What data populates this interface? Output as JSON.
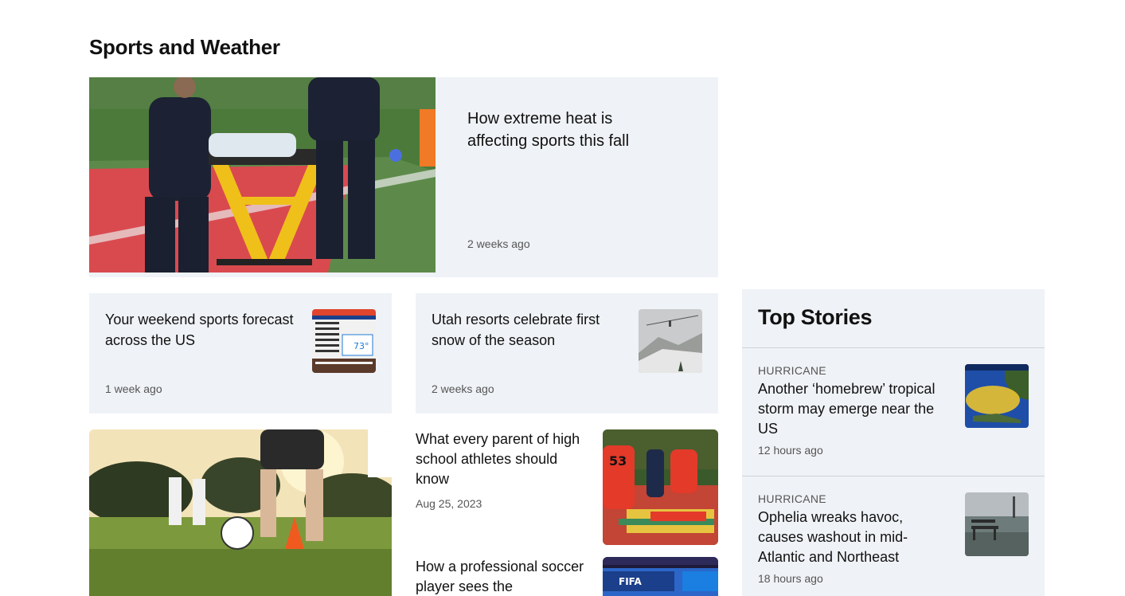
{
  "section": {
    "title": "Sports and Weather"
  },
  "hero": {
    "title": "How extreme heat is affecting sports this fall",
    "time": "2 weeks ago",
    "image": "paramedics-stretcher-field"
  },
  "cards": [
    {
      "title": "Your weekend sports forecast across the US",
      "time": "1 week ago",
      "thumb": "weather-forecast-screen"
    },
    {
      "title": "Utah resorts celebrate first snow of the season",
      "time": "2 weeks ago",
      "thumb": "snowy-ski-lift"
    }
  ],
  "big_image": "youth-soccer-practice",
  "stories": [
    {
      "title": "What every parent of high school athletes should know",
      "time": "Aug 25, 2023",
      "thumb": "football-training-drill"
    },
    {
      "title": "How a professional soccer player sees the",
      "time": "",
      "thumb": "fifa-stadium-screen"
    }
  ],
  "top_stories": {
    "title": "Top Stories",
    "items": [
      {
        "category": "HURRICANE",
        "headline": "Another ‘homebrew’ tropical storm may emerge near the US",
        "time": "12 hours ago",
        "thumb": "storm-map"
      },
      {
        "category": "HURRICANE",
        "headline": "Ophelia wreaks havoc, causes washout in mid-Atlantic and Northeast",
        "time": "18 hours ago",
        "thumb": "flooded-bench"
      }
    ]
  }
}
